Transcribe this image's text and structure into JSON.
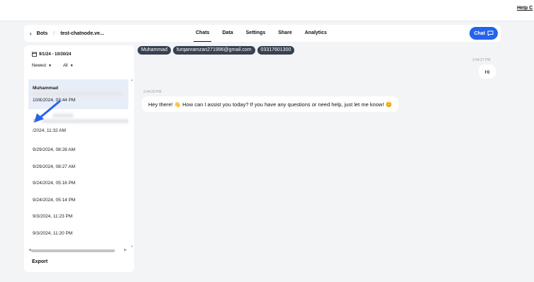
{
  "topbar": {
    "help_label": "Help C"
  },
  "nav": {
    "back_label": "Bots",
    "bot_name": "test-chatnode.ve...",
    "tabs": [
      {
        "label": "Chats",
        "active": true
      },
      {
        "label": "Data"
      },
      {
        "label": "Settings"
      },
      {
        "label": "Share"
      },
      {
        "label": "Analytics"
      }
    ],
    "chat_button": "Chat"
  },
  "sidebar": {
    "date_range": "9/1/24 - 10/30/24",
    "sort_label": "Newest",
    "filter_label": "All",
    "selected": {
      "name": "Muhammad",
      "datetime": "10/8/2024, 03:44 PM"
    },
    "flagged": {
      "datetime": "/2024, 11:32 AM"
    },
    "items": [
      "9/29/2024, 08:28 AM",
      "9/29/2024, 08:27 AM",
      "9/24/2024, 05:16 PM",
      "9/24/2024, 05:14 PM",
      "9/3/2024, 11:23 PM",
      "9/3/2024, 11:20 PM"
    ],
    "export_label": "Export"
  },
  "contact": {
    "chips": [
      "Muhammad",
      "furqanramzan271996@gmail.com",
      "03317601300"
    ]
  },
  "messages": {
    "user_time": "3:44:27 PM",
    "user_text": "Hi",
    "bot_time": "3:44:29 PM",
    "bot_text": "Hey there! 👋 How can I assist you today? If you have any questions or need help, just let me know! 😊"
  },
  "colors": {
    "accent": "#2563eb",
    "chip_bg": "#374151",
    "flag": "#e11d48"
  }
}
